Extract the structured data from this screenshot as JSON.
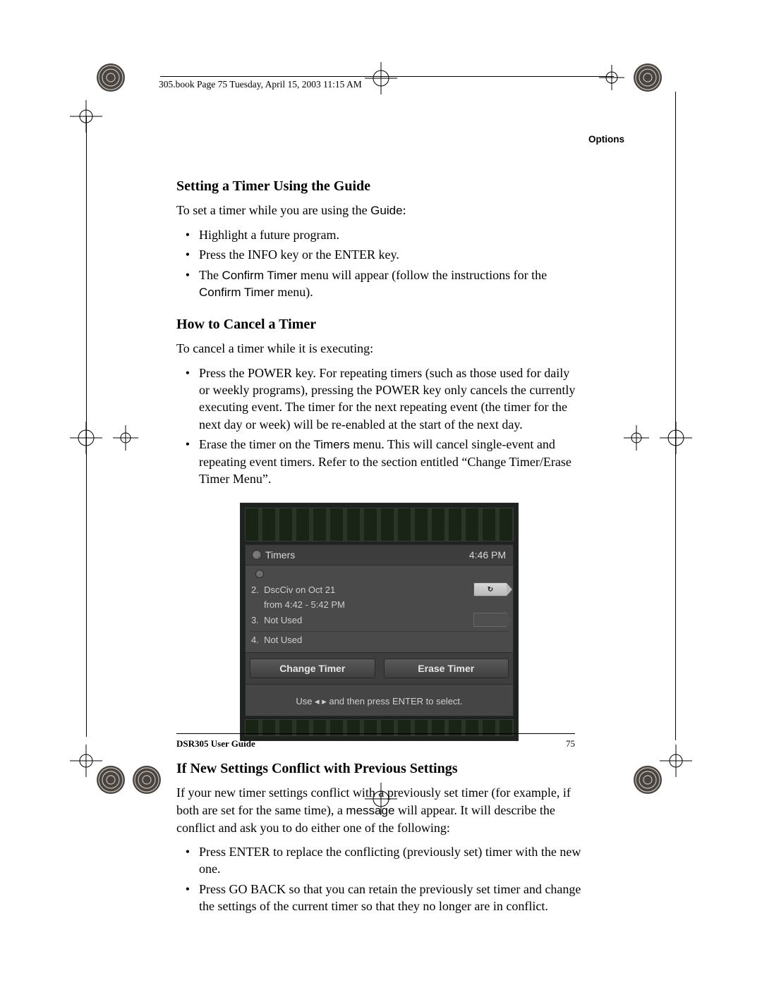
{
  "meta_line": "305.book  Page 75  Tuesday, April 15, 2003  11:15 AM",
  "chapter": "Options",
  "section1": {
    "heading": "Setting a Timer Using the Guide",
    "intro_a": "To set a timer while you are using the ",
    "intro_b": "Guide",
    "intro_c": ":",
    "bullets": {
      "b1": "Highlight a future program.",
      "b2": "Press the INFO key or the ENTER key.",
      "b3_a": "The ",
      "b3_b": "Confirm Timer",
      "b3_c": " menu will appear (follow the instructions for the ",
      "b3_d": "Confirm Timer",
      "b3_e": " menu)."
    }
  },
  "section2": {
    "heading": "How to Cancel a Timer",
    "intro": "To cancel a timer while it is executing:",
    "bullets": {
      "b1": "Press the POWER key. For repeating timers (such as those used for daily or weekly programs), pressing the POWER key only cancels the currently executing event. The timer for the next repeating event (the timer for the next day or week) will be re-enabled at the start of the next day.",
      "b2_a": "Erase the timer on the ",
      "b2_b": "Timers",
      "b2_c": " menu. This will cancel single-event and repeating event timers. Refer to the section entitled “Change Timer/Erase Timer Menu”."
    }
  },
  "osd": {
    "title": "Timers",
    "clock": "4:46 PM",
    "row2a": "2.  DscCiv on Oct 21",
    "row2b": "from 4:42 - 5:42 PM",
    "row3": "3.  Not Used",
    "row4": "4.  Not Used",
    "btn1": "Change Timer",
    "btn2": "Erase Timer",
    "hint": "Use ◂ ▸ and then press ENTER to select.",
    "tag_icon": "↻"
  },
  "section3": {
    "heading": "If New Settings Conflict with Previous Settings",
    "p_a": "If your new timer settings conflict with a previously set timer (for example, if both are set for the same time), a ",
    "p_b": "message",
    "p_c": " will appear. It will describe the conflict and ask you to do either one of the following:",
    "bullets": {
      "b1": "Press ENTER to replace the conflicting (previously set) timer with the new one.",
      "b2": "Press GO BACK so that you can retain the previously set timer and change the settings of the current timer so that they no longer are in conflict."
    }
  },
  "footer": {
    "left": "DSR305 User Guide",
    "right": "75"
  }
}
